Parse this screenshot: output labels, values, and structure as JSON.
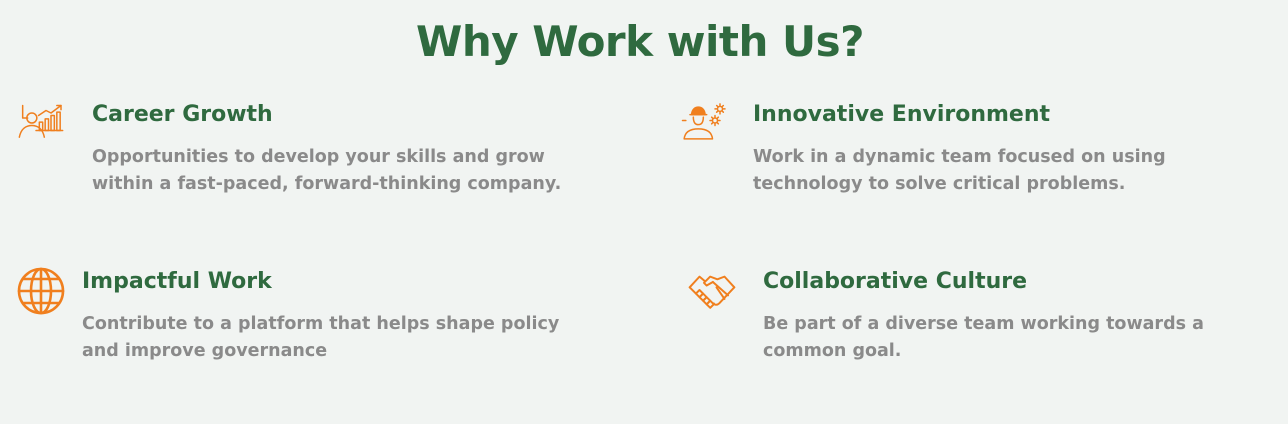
{
  "heading": "Why Work with Us?",
  "colors": {
    "heading": "#2f6a3f",
    "icon": "#f07f1e",
    "description": "#8a8a8a",
    "background": "#f1f4f2"
  },
  "features": [
    {
      "icon": "career-growth-chart-icon",
      "title": "Career Growth",
      "description": "Opportunities to develop your skills and grow within a fast-paced, forward-thinking company."
    },
    {
      "icon": "engineer-gears-icon",
      "title": "Innovative Environment",
      "description": "Work in a dynamic team focused on using technology to solve critical problems."
    },
    {
      "icon": "globe-icon",
      "title": "Impactful Work",
      "description": "Contribute to a platform that helps shape policy and improve governance"
    },
    {
      "icon": "handshake-icon",
      "title": "Collaborative Culture",
      "description": "Be part of a diverse team working towards a common goal."
    }
  ]
}
